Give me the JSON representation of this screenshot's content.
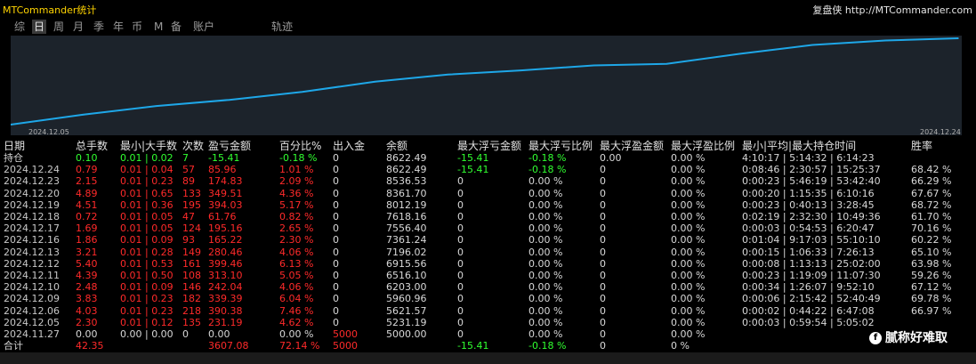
{
  "app_title": "MTCommander统计",
  "brand": {
    "name": "复盘侠",
    "url": "http://MTCommander.com"
  },
  "tabs": [
    {
      "label": "综",
      "active": false
    },
    {
      "label": "日",
      "active": true
    },
    {
      "label": "周",
      "active": false
    },
    {
      "label": "月",
      "active": false
    },
    {
      "label": "季",
      "active": false
    },
    {
      "label": "年",
      "active": false
    },
    {
      "label": "币",
      "active": false
    },
    {
      "label": "M",
      "active": false
    },
    {
      "label": "备",
      "active": false
    },
    {
      "label": "账户",
      "active": false
    },
    {
      "label": "轨迹",
      "active": false
    }
  ],
  "chart_data": {
    "type": "line",
    "x_start_label": "2024.12.05",
    "x_end_label": "2024.12.24",
    "x": [
      "2024.12.05",
      "2024.12.06",
      "2024.12.09",
      "2024.12.10",
      "2024.12.11",
      "2024.12.12",
      "2024.12.13",
      "2024.12.16",
      "2024.12.17",
      "2024.12.18",
      "2024.12.19",
      "2024.12.20",
      "2024.12.23",
      "2024.12.24"
    ],
    "values": [
      5231.19,
      5621.57,
      5960.96,
      6203.0,
      6516.1,
      6915.56,
      7196.02,
      7361.24,
      7556.4,
      7618.16,
      8012.19,
      8361.7,
      8536.53,
      8622.49
    ],
    "line_color": "#1ea7e8",
    "bg_color": "#1c232b"
  },
  "columns": [
    "日期",
    "总手数",
    "最小|大手数",
    "次数",
    "盈亏金额",
    "百分比%",
    "出入金",
    "余额",
    "最大浮亏金额",
    "最大浮亏比例",
    "最大浮盈金额",
    "最大浮盈比例",
    "最小|平均|最大持仓时间",
    "胜率"
  ],
  "position_row": {
    "date": "持仓",
    "lots": "0.10",
    "minmax": "0.01 | 0.02",
    "count": "7",
    "pnl": "-15.41",
    "pct": "-0.18 %",
    "flow": "0",
    "balance": "8622.49",
    "max_float_loss": "-15.41",
    "max_float_loss_pct": "-0.18 %",
    "max_float_profit": "0.00",
    "max_float_profit_pct": "0.00 %",
    "hold_time": "4:10:17 | 5:14:32 | 6:14:23",
    "win_rate": ""
  },
  "rows": [
    {
      "date": "2024.12.24",
      "lots": "0.79",
      "minmax": "0.01 | 0.04",
      "count": "57",
      "pnl": "85.96",
      "pct": "1.01 %",
      "flow": "0",
      "balance": "8622.49",
      "max_float_loss": "-15.41",
      "max_float_loss_pct": "-0.18 %",
      "max_float_profit": "0",
      "max_float_profit_pct": "0.00 %",
      "hold_time": "0:08:46 | 2:30:57 | 15:25:37",
      "win_rate": "68.42 %"
    },
    {
      "date": "2024.12.23",
      "lots": "2.15",
      "minmax": "0.01 | 0.23",
      "count": "89",
      "pnl": "174.83",
      "pct": "2.09 %",
      "flow": "0",
      "balance": "8536.53",
      "max_float_loss": "0",
      "max_float_loss_pct": "0.00 %",
      "max_float_profit": "0",
      "max_float_profit_pct": "0.00 %",
      "hold_time": "0:00:23 | 5:46:19 | 53:42:40",
      "win_rate": "66.29 %"
    },
    {
      "date": "2024.12.20",
      "lots": "4.89",
      "minmax": "0.01 | 0.65",
      "count": "133",
      "pnl": "349.51",
      "pct": "4.36 %",
      "flow": "0",
      "balance": "8361.70",
      "max_float_loss": "0",
      "max_float_loss_pct": "0.00 %",
      "max_float_profit": "0",
      "max_float_profit_pct": "0.00 %",
      "hold_time": "0:00:20 | 1:15:35 | 6:10:16",
      "win_rate": "67.67 %"
    },
    {
      "date": "2024.12.19",
      "lots": "4.51",
      "minmax": "0.01 | 0.36",
      "count": "195",
      "pnl": "394.03",
      "pct": "5.17 %",
      "flow": "0",
      "balance": "8012.19",
      "max_float_loss": "0",
      "max_float_loss_pct": "0.00 %",
      "max_float_profit": "0",
      "max_float_profit_pct": "0.00 %",
      "hold_time": "0:00:23 | 0:40:13 | 3:28:45",
      "win_rate": "68.72 %"
    },
    {
      "date": "2024.12.18",
      "lots": "0.72",
      "minmax": "0.01 | 0.05",
      "count": "47",
      "pnl": "61.76",
      "pct": "0.82 %",
      "flow": "0",
      "balance": "7618.16",
      "max_float_loss": "0",
      "max_float_loss_pct": "0.00 %",
      "max_float_profit": "0",
      "max_float_profit_pct": "0.00 %",
      "hold_time": "0:02:19 | 2:32:30 | 10:49:36",
      "win_rate": "61.70 %"
    },
    {
      "date": "2024.12.17",
      "lots": "1.69",
      "minmax": "0.01 | 0.05",
      "count": "124",
      "pnl": "195.16",
      "pct": "2.65 %",
      "flow": "0",
      "balance": "7556.40",
      "max_float_loss": "0",
      "max_float_loss_pct": "0.00 %",
      "max_float_profit": "0",
      "max_float_profit_pct": "0.00 %",
      "hold_time": "0:00:03 | 0:54:53 | 6:20:47",
      "win_rate": "70.16 %"
    },
    {
      "date": "2024.12.16",
      "lots": "1.86",
      "minmax": "0.01 | 0.09",
      "count": "93",
      "pnl": "165.22",
      "pct": "2.30 %",
      "flow": "0",
      "balance": "7361.24",
      "max_float_loss": "0",
      "max_float_loss_pct": "0.00 %",
      "max_float_profit": "0",
      "max_float_profit_pct": "0.00 %",
      "hold_time": "0:01:04 | 9:17:03 | 55:10:10",
      "win_rate": "60.22 %"
    },
    {
      "date": "2024.12.13",
      "lots": "3.21",
      "minmax": "0.01 | 0.28",
      "count": "149",
      "pnl": "280.46",
      "pct": "4.06 %",
      "flow": "0",
      "balance": "7196.02",
      "max_float_loss": "0",
      "max_float_loss_pct": "0.00 %",
      "max_float_profit": "0",
      "max_float_profit_pct": "0.00 %",
      "hold_time": "0:00:15 | 1:06:33 | 7:26:13",
      "win_rate": "65.10 %"
    },
    {
      "date": "2024.12.12",
      "lots": "5.40",
      "minmax": "0.01 | 0.53",
      "count": "161",
      "pnl": "399.46",
      "pct": "6.13 %",
      "flow": "0",
      "balance": "6915.56",
      "max_float_loss": "0",
      "max_float_loss_pct": "0.00 %",
      "max_float_profit": "0",
      "max_float_profit_pct": "0.00 %",
      "hold_time": "0:00:08 | 1:13:13 | 25:02:00",
      "win_rate": "63.98 %"
    },
    {
      "date": "2024.12.11",
      "lots": "4.39",
      "minmax": "0.01 | 0.50",
      "count": "108",
      "pnl": "313.10",
      "pct": "5.05 %",
      "flow": "0",
      "balance": "6516.10",
      "max_float_loss": "0",
      "max_float_loss_pct": "0.00 %",
      "max_float_profit": "0",
      "max_float_profit_pct": "0.00 %",
      "hold_time": "0:00:23 | 1:19:09 | 11:07:30",
      "win_rate": "59.26 %"
    },
    {
      "date": "2024.12.10",
      "lots": "2.48",
      "minmax": "0.01 | 0.09",
      "count": "146",
      "pnl": "242.04",
      "pct": "4.06 %",
      "flow": "0",
      "balance": "6203.00",
      "max_float_loss": "0",
      "max_float_loss_pct": "0.00 %",
      "max_float_profit": "0",
      "max_float_profit_pct": "0.00 %",
      "hold_time": "0:00:34 | 1:26:07 | 9:52:10",
      "win_rate": "67.12 %"
    },
    {
      "date": "2024.12.09",
      "lots": "3.83",
      "minmax": "0.01 | 0.23",
      "count": "182",
      "pnl": "339.39",
      "pct": "6.04 %",
      "flow": "0",
      "balance": "5960.96",
      "max_float_loss": "0",
      "max_float_loss_pct": "0.00 %",
      "max_float_profit": "0",
      "max_float_profit_pct": "0.00 %",
      "hold_time": "0:00:06 | 2:15:42 | 52:40:49",
      "win_rate": "69.78 %"
    },
    {
      "date": "2024.12.06",
      "lots": "4.03",
      "minmax": "0.01 | 0.23",
      "count": "218",
      "pnl": "390.38",
      "pct": "7.46 %",
      "flow": "0",
      "balance": "5621.57",
      "max_float_loss": "0",
      "max_float_loss_pct": "0.00 %",
      "max_float_profit": "0",
      "max_float_profit_pct": "0.00 %",
      "hold_time": "0:00:02 | 0:44:22 | 6:47:08",
      "win_rate": "66.97 %"
    },
    {
      "date": "2024.12.05",
      "lots": "2.30",
      "minmax": "0.01 | 0.12",
      "count": "135",
      "pnl": "231.19",
      "pct": "4.62 %",
      "flow": "0",
      "balance": "5231.19",
      "max_float_loss": "0",
      "max_float_loss_pct": "0.00 %",
      "max_float_profit": "0",
      "max_float_profit_pct": "0.00 %",
      "hold_time": "0:00:03 | 0:59:54 | 5:05:02",
      "win_rate": ""
    },
    {
      "date": "2024.11.27",
      "lots": "0.00",
      "minmax": "0.00 | 0.00",
      "count": "0",
      "pnl": "0.00",
      "pct": "0.00 %",
      "flow": "5000",
      "balance": "5000.00",
      "max_float_loss": "0",
      "max_float_loss_pct": "0.00 %",
      "max_float_profit": "0",
      "max_float_profit_pct": "0.00 %",
      "hold_time": "",
      "win_rate": ""
    }
  ],
  "total_row": {
    "date": "合计",
    "lots": "42.35",
    "pnl": "3607.08",
    "pct": "72.14 %",
    "flow": "5000",
    "max_float_loss": "-15.41",
    "max_float_loss_pct": "-0.18 %",
    "max_float_profit": "0",
    "max_float_profit_pct": "0 %"
  },
  "watermark": {
    "logo": "f",
    "text": "腻称好难取"
  }
}
